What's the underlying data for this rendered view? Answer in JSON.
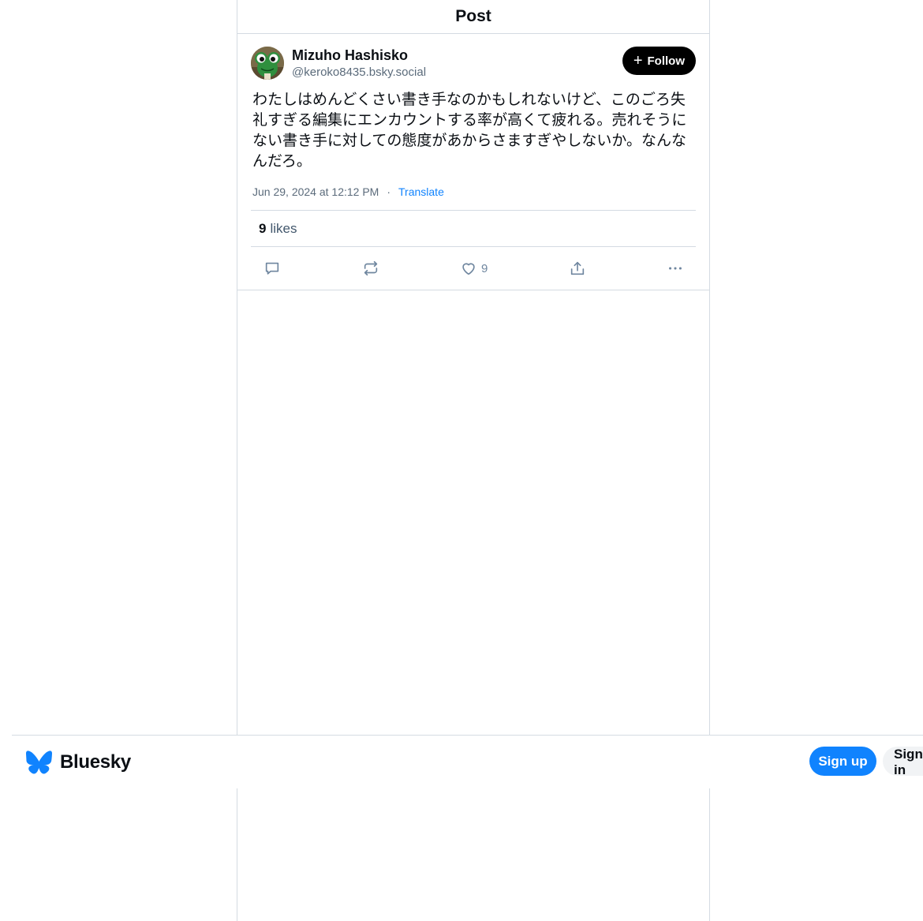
{
  "header": {
    "title": "Post"
  },
  "post": {
    "author": {
      "display_name": "Mizuho Hashisko",
      "handle": "@keroko8435.bsky.social",
      "avatar_icon": "frog-avatar"
    },
    "follow_label": "Follow",
    "text": "わたしはめんどくさい書き手なのかもしれないけど、このごろ失礼すぎる編集にエンカウントする率が高くて疲れる。売れそうにない書き手に対しての態度があからさますぎやしないか。なんなんだろ。",
    "timestamp": "Jun 29, 2024 at 12:12 PM",
    "meta_separator": "·",
    "translate_label": "Translate",
    "likes_count": "9",
    "likes_label": "likes",
    "actions": {
      "reply_icon": "reply-icon",
      "repost_icon": "repost-icon",
      "like_icon": "heart-icon",
      "like_count": "9",
      "share_icon": "share-icon",
      "more_icon": "more-icon"
    }
  },
  "footer": {
    "brand": "Bluesky",
    "brand_color": "#1083fe",
    "signup_label": "Sign up",
    "signin_label": "Sign in"
  }
}
